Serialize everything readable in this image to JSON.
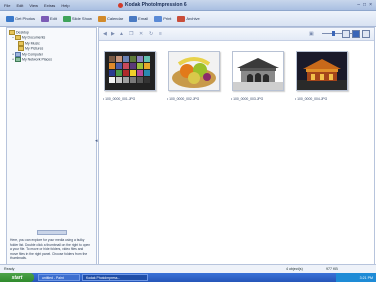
{
  "menu": [
    "File",
    "Edit",
    "View",
    "Extras",
    "Help"
  ],
  "app": {
    "title": "Kodak PhotoImpression 6"
  },
  "window_controls": [
    "–",
    "□",
    "×"
  ],
  "toolbar": [
    {
      "label": "Get Photos",
      "color": "#3a78c9"
    },
    {
      "label": "Edit",
      "color": "#7b5bb5"
    },
    {
      "label": "Slide Show",
      "color": "#3fa35a"
    },
    {
      "label": "Calendar",
      "color": "#d28a2a"
    },
    {
      "label": "Email",
      "color": "#4a7ac2"
    },
    {
      "label": "Print",
      "color": "#5a8ad6"
    },
    {
      "label": "Archive",
      "color": "#c94d3a"
    }
  ],
  "tree": [
    "Desktop",
    "My Documents",
    "My Music",
    "My Pictures",
    "My Computer",
    "My Network Places"
  ],
  "help_text": "Here, you can explore for your media using a bulky folder list. Double click a thumbnail on the right to open a your file. To move or hide folders, video files and move files in the right panel. Choose folders from the thumbnails.",
  "thumbnails": [
    {
      "caption": "• 100_0000_001.JPG",
      "kind": "color-chart"
    },
    {
      "caption": "• 100_0000_002.JPG",
      "kind": "fruit-basket"
    },
    {
      "caption": "• 100_0000_003.JPG",
      "kind": "temple-stone"
    },
    {
      "caption": "• 100_0000_004.JPG",
      "kind": "temple-night"
    }
  ],
  "status": {
    "left": "Ready",
    "center": "4 object(s)",
    "right": "977 KB"
  },
  "taskbar": {
    "start": "start",
    "tasks": [
      "untitled - Paint",
      "Kodak PhotoImpress..."
    ],
    "clock": "3:21 PM"
  }
}
